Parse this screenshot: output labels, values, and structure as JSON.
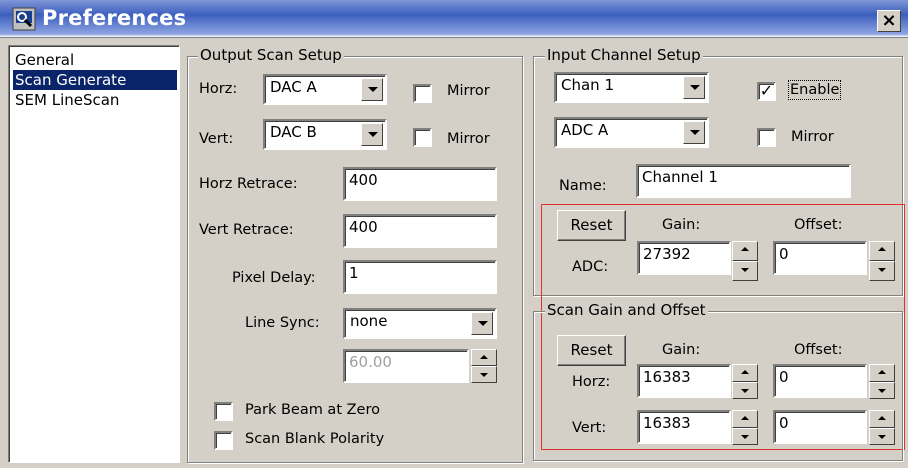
{
  "window": {
    "title": "Preferences",
    "close_glyph": "×"
  },
  "nav": {
    "items": [
      "General",
      "Scan Generate",
      "SEM LineScan"
    ],
    "selected": "Scan Generate"
  },
  "output_scan": {
    "legend": "Output Scan Setup",
    "horz_label": "Horz:",
    "horz_value": "DAC A",
    "vert_label": "Vert:",
    "vert_value": "DAC B",
    "mirror_label": "Mirror",
    "horz_mirror": false,
    "vert_mirror": false,
    "horz_retrace_label": "Horz Retrace:",
    "horz_retrace": "400",
    "vert_retrace_label": "Vert Retrace:",
    "vert_retrace": "400",
    "pixel_delay_label": "Pixel Delay:",
    "pixel_delay": "1",
    "line_sync_label": "Line Sync:",
    "line_sync": "none",
    "line_sync_freq": "60.00",
    "park_beam_label": "Park Beam at Zero",
    "park_beam": false,
    "scan_blank_label": "Scan Blank Polarity",
    "scan_blank": false
  },
  "input_channel": {
    "legend": "Input Channel Setup",
    "channel": "Chan 1",
    "enable_label": "Enable",
    "enable": true,
    "adc": "ADC A",
    "mirror_label": "Mirror",
    "mirror": false,
    "name_label": "Name:",
    "name": "Channel 1",
    "reset_label": "Reset",
    "gain_label": "Gain:",
    "offset_label": "Offset:",
    "adc_label": "ADC:",
    "adc_gain": "27392",
    "adc_offset": "0"
  },
  "scan_gain": {
    "legend": "Scan Gain and Offset",
    "reset_label": "Reset",
    "gain_label": "Gain:",
    "offset_label": "Offset:",
    "horz_label": "Horz:",
    "horz_gain": "16383",
    "horz_offset": "0",
    "vert_label": "Vert:",
    "vert_gain": "16383",
    "vert_offset": "0"
  },
  "colors": {
    "titlebar": "#3c5fbf",
    "selection": "#0a246a",
    "highlight_box": "#e03030",
    "face": "#d4d0c8"
  }
}
